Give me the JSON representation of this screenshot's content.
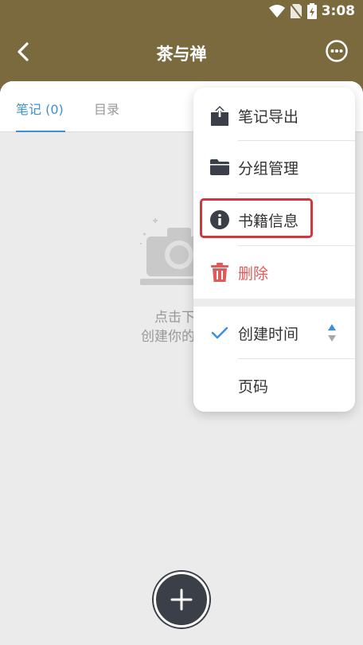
{
  "status_bar": {
    "time": "3:08"
  },
  "app_bar": {
    "title": "茶与禅"
  },
  "tabs": [
    {
      "label": "笔记 (0)"
    },
    {
      "label": "目录"
    }
  ],
  "empty_state": {
    "line1": "点击下方",
    "line2": "创建你的第一"
  },
  "menu": {
    "items": [
      {
        "label": "笔记导出",
        "icon": "share-upload-icon"
      },
      {
        "label": "分组管理",
        "icon": "folder-icon"
      },
      {
        "label": "书籍信息",
        "icon": "info-icon"
      },
      {
        "label": "删除",
        "icon": "trash-icon"
      }
    ],
    "sort_options": [
      {
        "label": "创建时间",
        "selected": true
      },
      {
        "label": "页码",
        "selected": false
      }
    ]
  },
  "colors": {
    "header": "#7c6a3f",
    "accent": "#3c8fd8",
    "danger": "#e05a5a",
    "highlight": "#d0373f"
  }
}
